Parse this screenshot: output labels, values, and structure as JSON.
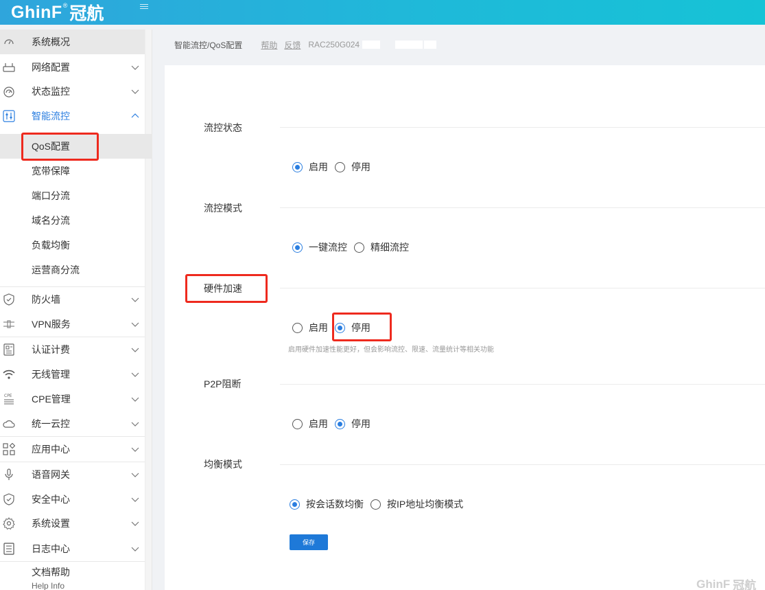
{
  "header": {
    "logo_en": "GhinF",
    "logo_reg": "®",
    "logo_cn": "冠航"
  },
  "sidebar": {
    "items": [
      {
        "label": "系统概况",
        "icon": "dashboard-icon"
      },
      {
        "label": "网络配置",
        "icon": "router-icon"
      },
      {
        "label": "状态监控",
        "icon": "gauge-icon"
      },
      {
        "label": "智能流控",
        "icon": "sliders-icon"
      },
      {
        "label": "防火墙",
        "icon": "shield-icon"
      },
      {
        "label": "VPN服务",
        "icon": "vpn-icon"
      },
      {
        "label": "认证计费",
        "icon": "auth-icon"
      },
      {
        "label": "无线管理",
        "icon": "wifi-icon"
      },
      {
        "label": "CPE管理",
        "icon": "cpe-icon"
      },
      {
        "label": "统一云控",
        "icon": "cloud-icon"
      },
      {
        "label": "应用中心",
        "icon": "apps-icon"
      },
      {
        "label": "语音网关",
        "icon": "microphone-icon"
      },
      {
        "label": "安全中心",
        "icon": "shield-check-icon"
      },
      {
        "label": "系统设置",
        "icon": "gear-icon"
      },
      {
        "label": "日志中心",
        "icon": "log-icon"
      },
      {
        "label": "文档帮助"
      }
    ],
    "sub_items": [
      {
        "label": "QoS配置"
      },
      {
        "label": "宽带保障"
      },
      {
        "label": "端口分流"
      },
      {
        "label": "域名分流"
      },
      {
        "label": "负载均衡"
      },
      {
        "label": "运营商分流"
      }
    ],
    "help_en": "Help Info"
  },
  "breadcrumb": {
    "path": "智能流控/QoS配置",
    "help": "帮助",
    "feedback": "反馈",
    "model": "RAC250G024"
  },
  "form": {
    "sections": [
      {
        "title": "流控状态",
        "options": [
          "启用",
          "停用"
        ],
        "selected": 0
      },
      {
        "title": "流控模式",
        "options": [
          "一键流控",
          "精细流控"
        ],
        "selected": 0
      },
      {
        "title": "硬件加速",
        "options": [
          "启用",
          "停用"
        ],
        "selected": 1,
        "hint": "启用硬件加速性能更好，但会影响流控、限速、流量统计等相关功能"
      },
      {
        "title": "P2P阻断",
        "options": [
          "启用",
          "停用"
        ],
        "selected": 1
      },
      {
        "title": "均衡模式",
        "options": [
          "按会话数均衡",
          "按IP地址均衡模式"
        ],
        "selected": 0
      }
    ],
    "save_label": "保存"
  },
  "watermark": {
    "en": "GhinF",
    "cn": "冠航"
  },
  "colors": {
    "accent": "#2a7ee0",
    "highlight": "#ee2a1e",
    "header_start": "#2fa5dc",
    "header_end": "#16c3d6"
  }
}
